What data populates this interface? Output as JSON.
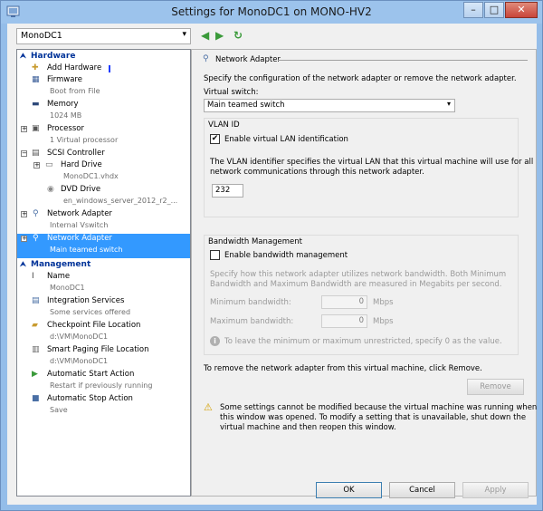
{
  "window": {
    "title": "Settings for MonoDC1 on MONO-HV2"
  },
  "titlebar": {
    "min_glyph": "–",
    "max_glyph": "□",
    "close_glyph": "✕"
  },
  "toolbar": {
    "vm_name": "MonoDC1",
    "back_glyph": "◀",
    "forward_glyph": "▶",
    "refresh_glyph": "↻"
  },
  "sidebar": {
    "hardware_header": "Hardware",
    "management_header": "Management",
    "items": [
      {
        "label": "Add Hardware",
        "sub": ""
      },
      {
        "label": "Firmware",
        "sub": "Boot from File"
      },
      {
        "label": "Memory",
        "sub": "1024 MB"
      },
      {
        "label": "Processor",
        "sub": "1 Virtual processor"
      },
      {
        "label": "SCSI Controller",
        "sub": ""
      },
      {
        "label": "Hard Drive",
        "sub": "MonoDC1.vhdx"
      },
      {
        "label": "DVD Drive",
        "sub": "en_windows_server_2012_r2_..."
      },
      {
        "label": "Network Adapter",
        "sub": "Internal Vswitch"
      },
      {
        "label": "Network Adapter",
        "sub": "Main teamed switch"
      }
    ],
    "mgmt_items": [
      {
        "label": "Name",
        "sub": "MonoDC1"
      },
      {
        "label": "Integration Services",
        "sub": "Some services offered"
      },
      {
        "label": "Checkpoint File Location",
        "sub": "d:\\VM\\MonoDC1"
      },
      {
        "label": "Smart Paging File Location",
        "sub": "d:\\VM\\MonoDC1"
      },
      {
        "label": "Automatic Start Action",
        "sub": "Restart if previously running"
      },
      {
        "label": "Automatic Stop Action",
        "sub": "Save"
      }
    ]
  },
  "detail": {
    "title": "Network Adapter",
    "intro": "Specify the configuration of the network adapter or remove the network adapter.",
    "vswitch_label": "Virtual switch:",
    "vswitch_value": "Main teamed switch",
    "vlan_group": "VLAN ID",
    "vlan_checkbox": "Enable virtual LAN identification",
    "vlan_checked": true,
    "vlan_desc_1": "The VLAN identifier specifies the virtual LAN that this virtual machine will use for all",
    "vlan_desc_2": "network communications through this network adapter.",
    "vlan_id": "232",
    "bw_group": "Bandwidth Management",
    "bw_checkbox": "Enable bandwidth management",
    "bw_checked": false,
    "bw_desc_1": "Specify how this network adapter utilizes network bandwidth. Both Minimum",
    "bw_desc_2": "Bandwidth and Maximum Bandwidth are measured in Megabits per second.",
    "min_bw_label": "Minimum bandwidth:",
    "min_bw_value": "0",
    "max_bw_label": "Maximum bandwidth:",
    "max_bw_value": "0",
    "unit": "Mbps",
    "bw_note": "To leave the minimum or maximum unrestricted, specify 0 as the value.",
    "remove_text": "To remove the network adapter from this virtual machine, click Remove.",
    "remove_button": "Remove",
    "warning_1": "Some settings cannot be modified because the virtual machine was running when",
    "warning_2": "this window was opened. To modify a setting that is unavailable, shut down the",
    "warning_3": "virtual machine and then reopen this window."
  },
  "footer": {
    "ok": "OK",
    "cancel": "Cancel",
    "apply": "Apply"
  }
}
